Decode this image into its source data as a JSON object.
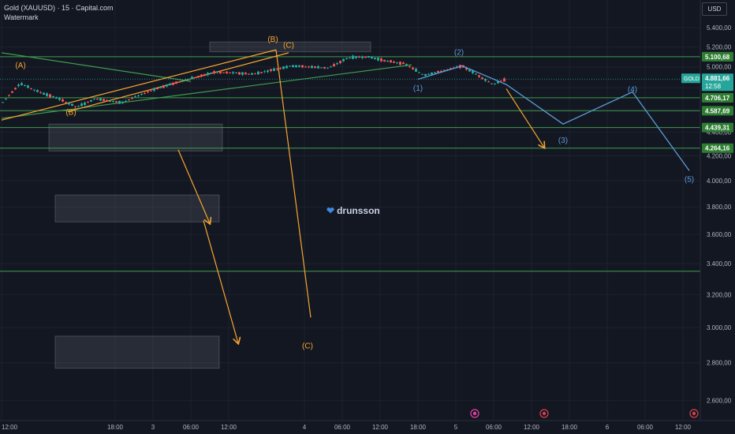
{
  "header": {
    "instrument": "Gold (XAUUSD) · 15 · Capital.com",
    "watermark": "Watermark",
    "currency_button": "USD",
    "brand": "drunsson"
  },
  "price_badge": {
    "symbol": "GOLD",
    "price": "4.881,66",
    "countdown": "12:58"
  },
  "colors": {
    "background": "#131722",
    "grid": "#1e222d",
    "horizontal_level": "#3e9b4f",
    "orange_wave": "#f7a530",
    "blue_wave": "#5b9bd5",
    "candle_up": "#26a69a",
    "candle_down": "#ef5350",
    "level_label_bg": "#2e7d32"
  },
  "chart_data": {
    "type": "candlestick",
    "instrument": "Gold (XAUUSD)",
    "timeframe": "15",
    "y_axis": {
      "scale": "log",
      "range": [
        2500,
        5700
      ],
      "ticks": [
        "5.400,00",
        "5.200,00",
        "5.000,00",
        "4.800,00",
        "4.600,00",
        "4.400,00",
        "4.200,00",
        "4.000,00",
        "3.800,00",
        "3.600,00",
        "3.400,00",
        "3.200,00",
        "3.000,00",
        "2.800,00",
        "2.600,00"
      ],
      "tick_values": [
        5400,
        5200,
        5000,
        4800,
        4600,
        4400,
        4200,
        4000,
        3800,
        3600,
        3400,
        3200,
        3000,
        2800,
        2600
      ]
    },
    "x_axis": {
      "range_hours": [
        0,
        140
      ],
      "ticks": [
        "12:00",
        "18:00",
        "3",
        "06:00",
        "12:00",
        "4",
        "06:00",
        "12:00",
        "18:00",
        "5",
        "06:00",
        "12:00",
        "18:00",
        "6",
        "06:00",
        "12:00"
      ],
      "tick_hours": [
        0,
        18,
        24,
        30,
        36,
        48,
        54,
        60,
        66,
        72,
        78,
        84,
        90,
        96,
        102,
        108
      ]
    },
    "current_price": 4881.66,
    "horizontal_levels": [
      {
        "value": 5100.68,
        "label": "5.100,68"
      },
      {
        "value": 4706.17,
        "label": "4.706,17"
      },
      {
        "value": 4587.69,
        "label": "4.587,69"
      },
      {
        "value": 4439.31,
        "label": "4.439,31"
      },
      {
        "value": 4264.16,
        "label": "4.264,16"
      },
      {
        "value": 3350,
        "label": ""
      }
    ],
    "price_path": [
      {
        "t": 0,
        "p": 4650
      },
      {
        "t": 3,
        "p": 4840
      },
      {
        "t": 6,
        "p": 4760
      },
      {
        "t": 9,
        "p": 4700
      },
      {
        "t": 12,
        "p": 4620
      },
      {
        "t": 15,
        "p": 4700
      },
      {
        "t": 19,
        "p": 4660
      },
      {
        "t": 24,
        "p": 4780
      },
      {
        "t": 29,
        "p": 4870
      },
      {
        "t": 34,
        "p": 4950
      },
      {
        "t": 40,
        "p": 4930
      },
      {
        "t": 46,
        "p": 5010
      },
      {
        "t": 52,
        "p": 4990
      },
      {
        "t": 55,
        "p": 5090
      },
      {
        "t": 58,
        "p": 5100
      },
      {
        "t": 61,
        "p": 5060
      },
      {
        "t": 64,
        "p": 5030
      },
      {
        "t": 67,
        "p": 4920
      },
      {
        "t": 70,
        "p": 4960
      },
      {
        "t": 73,
        "p": 5010
      },
      {
        "t": 75,
        "p": 4940
      },
      {
        "t": 78,
        "p": 4830
      },
      {
        "t": 80,
        "p": 4881.66
      }
    ],
    "wave_labels": [
      {
        "text": "(A)",
        "t": 3,
        "p": 4990,
        "series": "orange"
      },
      {
        "text": "(B)",
        "t": 11,
        "p": 4550,
        "series": "orange"
      },
      {
        "text": "(B)",
        "t": 43,
        "p": 5250,
        "series": "orange"
      },
      {
        "text": "(C)",
        "t": 45.5,
        "p": 5190,
        "series": "orange"
      },
      {
        "text": "(C)",
        "t": 48.5,
        "p": 2880,
        "series": "orange"
      },
      {
        "text": "(1)",
        "t": 66,
        "p": 4770,
        "series": "blue"
      },
      {
        "text": "(2)",
        "t": 72.5,
        "p": 5120,
        "series": "blue"
      },
      {
        "text": "(3)",
        "t": 89,
        "p": 4310,
        "series": "blue"
      },
      {
        "text": "(4)",
        "t": 100,
        "p": 4760,
        "series": "blue"
      },
      {
        "text": "(5)",
        "t": 109,
        "p": 3990,
        "series": "blue"
      }
    ],
    "projection_blue": [
      {
        "t": 66,
        "p": 4880
      },
      {
        "t": 73,
        "p": 5010
      },
      {
        "t": 80,
        "p": 4830
      },
      {
        "t": 89,
        "p": 4470
      },
      {
        "t": 100,
        "p": 4760
      },
      {
        "t": 109,
        "p": 4080
      }
    ],
    "projection_orange": [
      {
        "t": 80,
        "p": 4790
      },
      {
        "t": 86,
        "p": 4270
      }
    ],
    "arrows_orange": [
      [
        {
          "t": 28,
          "p": 4250
        },
        {
          "t": 33,
          "p": 3680
        }
      ],
      [
        {
          "t": 32,
          "p": 3700
        },
        {
          "t": 37.5,
          "p": 2910
        }
      ]
    ],
    "wave_c_drop": [
      {
        "t": 43.5,
        "p": 5170
      },
      {
        "t": 49,
        "p": 3060
      }
    ],
    "zones": [
      {
        "t1": 33,
        "t2": 58.5,
        "p1": 5150,
        "p2": 5250
      },
      {
        "t1": 7.5,
        "t2": 35,
        "p1": 4240,
        "p2": 4470
      },
      {
        "t1": 8.5,
        "t2": 34.5,
        "p1": 3690,
        "p2": 3890
      },
      {
        "t1": 8.5,
        "t2": 34.5,
        "p1": 2770,
        "p2": 2950
      }
    ],
    "trendlines": [
      {
        "from": {
          "t": 0,
          "p": 5140
        },
        "to": {
          "t": 30,
          "p": 4860
        },
        "color": "green"
      },
      {
        "from": {
          "t": 0,
          "p": 4520
        },
        "to": {
          "t": 65,
          "p": 5020
        },
        "color": "green"
      },
      {
        "from": {
          "t": 0,
          "p": 4505
        },
        "to": {
          "t": 43.5,
          "p": 5170
        },
        "color": "orange"
      },
      {
        "from": {
          "t": 10.5,
          "p": 4580
        },
        "to": {
          "t": 45.5,
          "p": 5140
        },
        "color": "orange"
      }
    ]
  }
}
